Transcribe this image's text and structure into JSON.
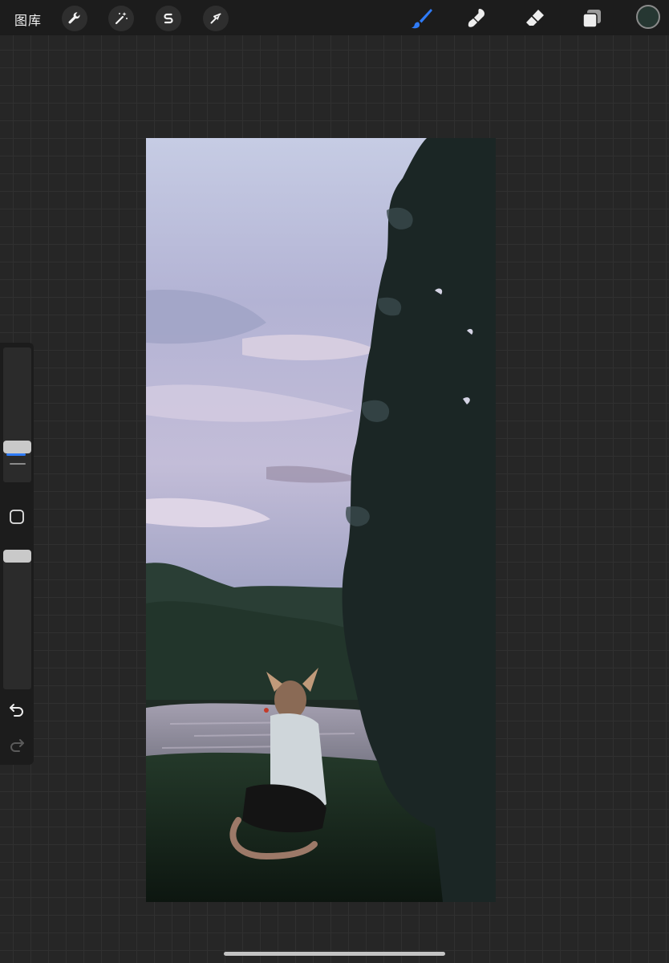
{
  "toolbar": {
    "gallery_label": "图库",
    "left_tools": [
      "wrench-icon",
      "magic-wand-icon",
      "selection-s-icon",
      "transform-arrow-icon"
    ],
    "right_tools": [
      "brush-icon",
      "smudge-icon",
      "eraser-icon",
      "layers-icon"
    ],
    "active_tool": "brush-icon",
    "current_color": "#263732",
    "accent_color": "#2f7bf6"
  },
  "sidebar": {
    "size_level": 0.24,
    "opacity_level": 1.0,
    "controls": [
      "modify-square-icon",
      "undo-icon",
      "redo-icon"
    ]
  },
  "canvas": {
    "palette": {
      "sky_top": "#c2c8e2",
      "sky_mid": "#b9b8d6",
      "sky_low": "#a8a9c6",
      "tree": "#1e2a2a",
      "grass": "#1e3622",
      "water": "#b7b0be"
    }
  }
}
